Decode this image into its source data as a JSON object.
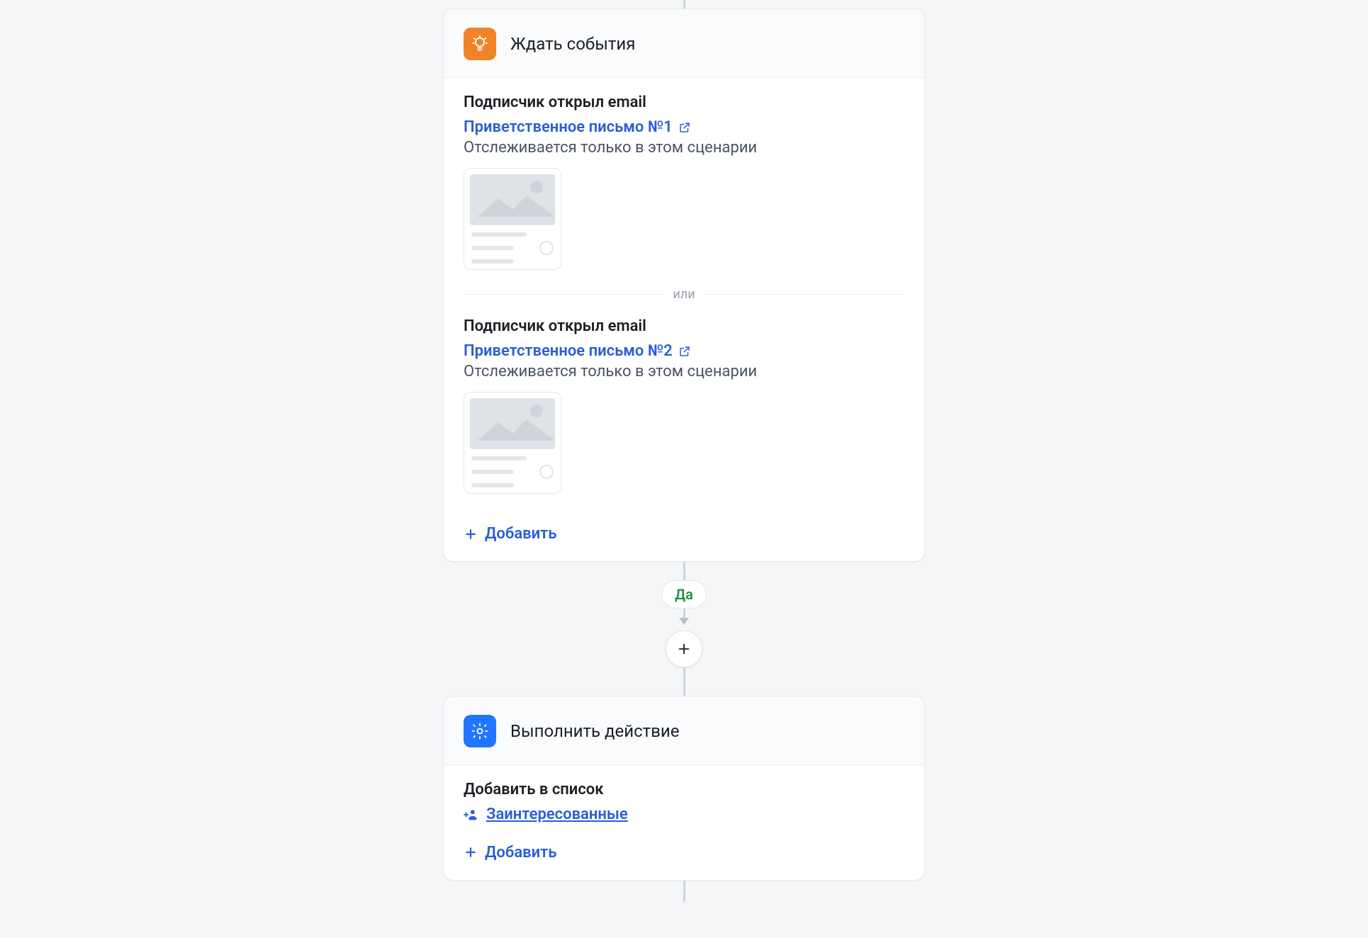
{
  "flow": {
    "branchLabel": "Да",
    "addLabel": "Добавить",
    "orLabel": "или"
  },
  "waitCard": {
    "title": "Ждать события",
    "events": [
      {
        "title": "Подписчик открыл email",
        "link": "Приветственное письмо №1",
        "sub": "Отслеживается только в этом сценарии"
      },
      {
        "title": "Подписчик открыл email",
        "link": "Приветственное письмо №2",
        "sub": "Отслеживается только в этом сценарии"
      }
    ]
  },
  "actionCard": {
    "title": "Выполнить действие",
    "action": {
      "title": "Добавить в список",
      "list": "Заинтересованные"
    }
  }
}
